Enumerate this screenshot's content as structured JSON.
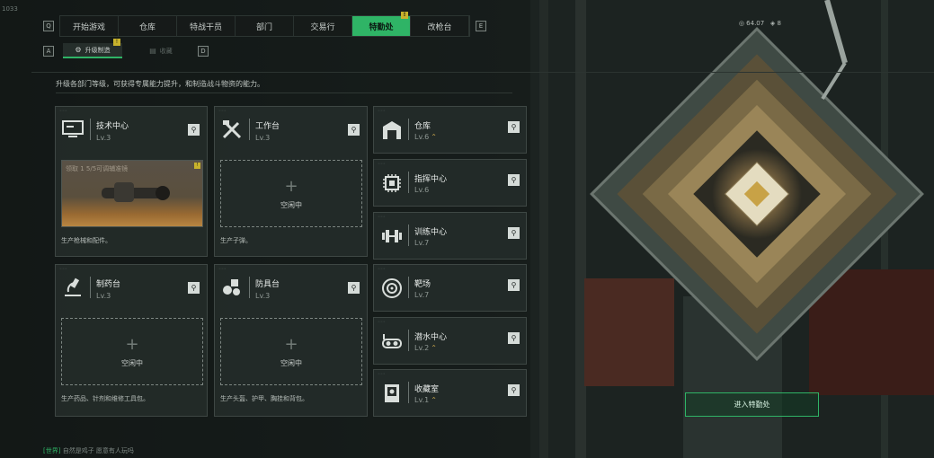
{
  "corner_id": "1033",
  "status": {
    "balance": "64.07",
    "count": "8"
  },
  "nav": {
    "tabs": [
      {
        "label": "开始游戏"
      },
      {
        "label": "仓库"
      },
      {
        "label": "特战干员"
      },
      {
        "label": "部门"
      },
      {
        "label": "交易行"
      },
      {
        "label": "特勤处",
        "badge": "!"
      },
      {
        "label": "改枪台"
      }
    ],
    "left_key": "Q",
    "right_key": "E"
  },
  "subnav": {
    "left_key": "A",
    "right_key": "D",
    "tabs": [
      {
        "label": "升级制造",
        "badge": "!"
      },
      {
        "label": "收藏"
      }
    ]
  },
  "description": "升级各部门等级，可获得专属能力提升，和制造战斗物资的能力。",
  "facilities": {
    "tech_center": {
      "name": "技术中心",
      "level": "Lv.3",
      "production_note": "领取 1 5/5可调辅准镜",
      "footer": "生产枪械和配件。"
    },
    "workbench": {
      "name": "工作台",
      "level": "Lv.3",
      "slot_text": "空闲中",
      "footer": "生产子弹。"
    },
    "pharmacy": {
      "name": "制药台",
      "level": "Lv.3",
      "slot_text": "空闲中",
      "footer": "生产药品、针剂和维修工具包。"
    },
    "armory": {
      "name": "防具台",
      "level": "Lv.3",
      "slot_text": "空闲中",
      "footer": "生产头盔、护甲、胸挂和背包。"
    },
    "list": [
      {
        "name": "仓库",
        "level": "Lv.6",
        "up": true,
        "icon": "warehouse-icon"
      },
      {
        "name": "指挥中心",
        "level": "Lv.6",
        "up": false,
        "icon": "chip-icon"
      },
      {
        "name": "训练中心",
        "level": "Lv.7",
        "up": false,
        "icon": "dumbbell-icon"
      },
      {
        "name": "靶场",
        "level": "Lv.7",
        "up": false,
        "icon": "target-icon"
      },
      {
        "name": "潜水中心",
        "level": "Lv.2",
        "up": true,
        "icon": "diving-goggles-icon"
      },
      {
        "name": "收藏室",
        "level": "Lv.1",
        "up": true,
        "icon": "display-case-icon"
      }
    ]
  },
  "enter_button": "进入特勤处",
  "chat": {
    "channel": "[世界]",
    "text": "自然是鸡子  愿意有人玩吗"
  },
  "colors": {
    "accent": "#2fb466",
    "badge": "#c7b22c",
    "upgrade": "#c9a64c"
  }
}
